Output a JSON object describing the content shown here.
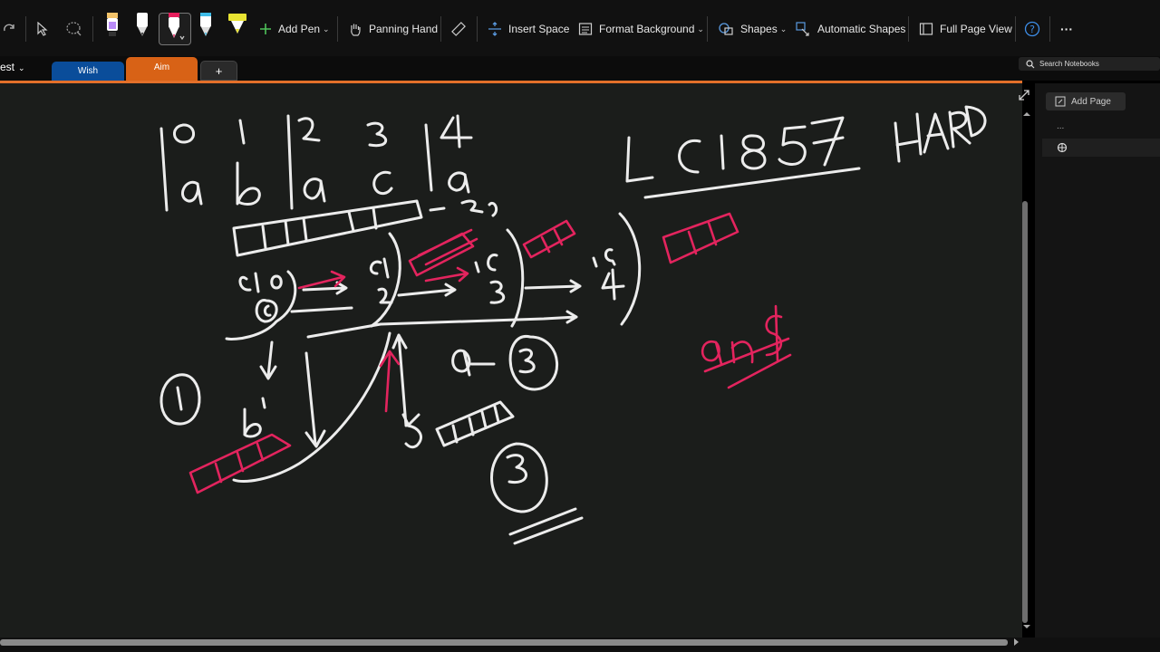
{
  "ribbon": {
    "tools": [
      {
        "name": "redo-icon",
        "interactable": true
      },
      {
        "name": "select-pointer-icon",
        "interactable": true
      },
      {
        "name": "lasso-icon",
        "interactable": true
      }
    ],
    "pens": [
      {
        "name": "pen-black-purple",
        "colors": [
          "#000000",
          "#b98af7"
        ]
      },
      {
        "name": "pen-white",
        "colors": [
          "#ffffff",
          "#444444"
        ]
      },
      {
        "name": "pen-pink",
        "colors": [
          "#e51e5c",
          "#ffffff"
        ]
      },
      {
        "name": "pen-cyan",
        "colors": [
          "#3fbce8",
          "#ffffff"
        ]
      },
      {
        "name": "highlighter-yellow",
        "colors": [
          "#e8e332",
          "#444444"
        ]
      }
    ],
    "add_pen": "Add Pen",
    "panning_hand": "Panning Hand",
    "insert_space": "Insert Space",
    "format_background": "Format Background",
    "shapes": "Shapes",
    "automatic_shapes": "Automatic Shapes",
    "full_page_view": "Full Page View",
    "more": "···"
  },
  "tabs": {
    "notebook": "est",
    "items": [
      {
        "label": "Wish",
        "color": "#0a4d9a"
      },
      {
        "label": "Aim",
        "color": "#d86216"
      }
    ],
    "add": "+"
  },
  "search": {
    "placeholder": "Search Notebooks"
  },
  "sidebar": {
    "add_page": "Add Page",
    "dots": "..."
  },
  "colors": {
    "accent": "#e3702a",
    "ink_white": "#ececec",
    "ink_pink": "#e3245e",
    "canvas": "#1b1d1b"
  }
}
